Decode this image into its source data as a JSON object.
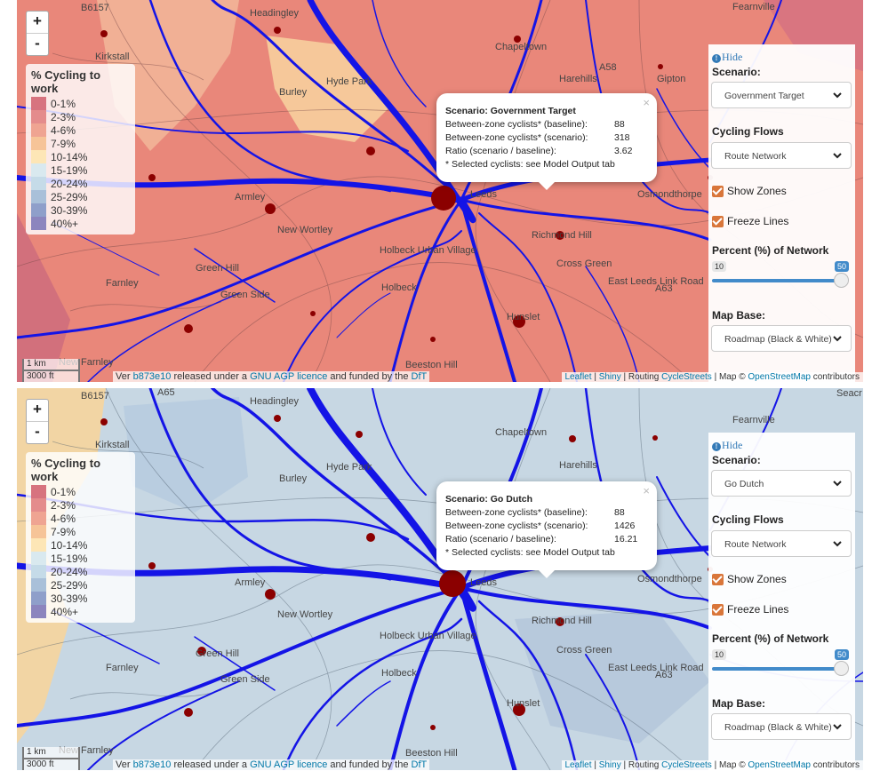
{
  "legend": {
    "title": "% Cycling to work",
    "items": [
      {
        "label": "0-1%",
        "color": "#d7737f"
      },
      {
        "label": "2-3%",
        "color": "#e48c8c"
      },
      {
        "label": "4-6%",
        "color": "#efa492"
      },
      {
        "label": "7-9%",
        "color": "#f6c498"
      },
      {
        "label": "10-14%",
        "color": "#fde6b6"
      },
      {
        "label": "15-19%",
        "color": "#d9e9ef"
      },
      {
        "label": "20-24%",
        "color": "#c5dbe8"
      },
      {
        "label": "25-29%",
        "color": "#a9c0d9"
      },
      {
        "label": "30-39%",
        "color": "#8f9fca"
      },
      {
        "label": "40%+",
        "color": "#8c85be"
      }
    ]
  },
  "map_labels": {
    "b6157": "B6157",
    "headingley": "Headingley",
    "kirkstall": "Kirkstall",
    "burley": "Burley",
    "hyde_park": "Hyde Park",
    "chapeltown": "Chapeltown",
    "harehills": "Harehills",
    "gipton": "Gipton",
    "fearnville": "Fearnville",
    "armley": "Armley",
    "new_wortley": "New Wortley",
    "holbeck_urban_village": "Holbeck Urban Village",
    "holbeck": "Holbeck",
    "green_hill": "Green Hill",
    "green_side": "Green Side",
    "farnley": "Farnley",
    "new_farnley": "New Farnley",
    "richmond_hill": "Richmond Hill",
    "cross_green": "Cross Green",
    "osmondthorpe": "Osmondthorpe",
    "hunslet": "Hunslet",
    "beeston_hill": "Beeston Hill",
    "a63": "A63",
    "a58": "A58",
    "a65": "A65",
    "leeds": "Leeds",
    "seacroft": "Seacr",
    "east_leeds_link_road": "East Leeds Link Road"
  },
  "zoom": {
    "in": "+",
    "out": "-"
  },
  "scale": {
    "km": "1 km",
    "ft": "3000 ft"
  },
  "attribution": {
    "ver": "Ver",
    "commit": "b873e10",
    "released": "released under a",
    "licence": "GNU AGP licence",
    "funded": "and funded by the",
    "dft": "DfT",
    "leaflet": "Leaflet",
    "sep1": "|",
    "shiny": "Shiny",
    "routing": "| Routing",
    "cyclestreets": "CycleStreets",
    "map": "| Map ©",
    "osm": "OpenStreetMap",
    "contributors": "contributors"
  },
  "controls": {
    "hide": "Hide",
    "scenario_label": "Scenario:",
    "cycling_flows_label": "Cycling Flows",
    "cycling_flows_value": "Route Network",
    "show_zones": "Show Zones",
    "freeze_lines": "Freeze Lines",
    "percent_label": "Percent (%) of Network",
    "slider_min": "10",
    "slider_max": "50",
    "slider_value": 50,
    "map_base_label": "Map Base:",
    "map_base_value": "Roadmap (Black & White)"
  },
  "panels": [
    {
      "scenario": "Government Target",
      "popup": {
        "title": "Scenario: Government Target",
        "baseline_label": "Between-zone cyclists* (baseline):",
        "baseline_value": "88",
        "scenario_label": "Between-zone cyclists* (scenario):",
        "scenario_value": "318",
        "ratio_label": "Ratio (scenario / baseline):",
        "ratio_value": "3.62",
        "note": "* Selected cyclists: see Model Output tab",
        "close": "×"
      }
    },
    {
      "scenario": "Go Dutch",
      "popup": {
        "title": "Scenario: Go Dutch",
        "baseline_label": "Between-zone cyclists* (baseline):",
        "baseline_value": "88",
        "scenario_label": "Between-zone cyclists* (scenario):",
        "scenario_value": "1426",
        "ratio_label": "Ratio (scenario / baseline):",
        "ratio_value": "16.21",
        "note": "* Selected cyclists: see Model Output tab",
        "close": "×"
      }
    }
  ],
  "colors": {
    "route": "#1414e6",
    "centroid": "#8b0000",
    "top_fill": "#e9877a",
    "bottom_fill": "#c7d7e3"
  }
}
